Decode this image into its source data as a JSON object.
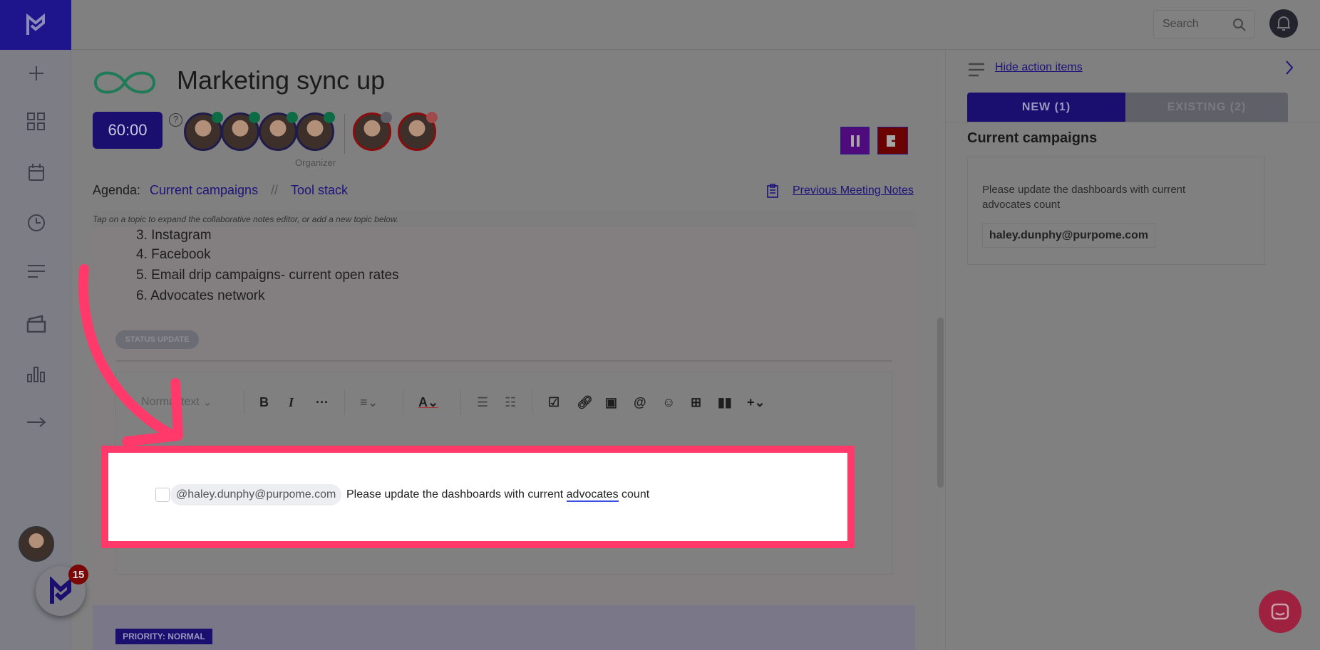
{
  "app": {
    "logo": "meetingfull-logo",
    "colors": {
      "brand": "#1e158c",
      "highlight": "#ff3a6a"
    }
  },
  "topbar": {
    "search_placeholder": "Search",
    "bell": "bell-icon"
  },
  "sidebar": {
    "items": [
      {
        "icon": "plus-icon"
      },
      {
        "icon": "grid-icon"
      },
      {
        "icon": "calendar-icon"
      },
      {
        "icon": "clock-icon"
      },
      {
        "icon": "notes-icon"
      },
      {
        "icon": "folder-icon"
      },
      {
        "icon": "chart-icon"
      },
      {
        "icon": "arrow-right-icon"
      }
    ],
    "badge_count": "15"
  },
  "meeting": {
    "title": "Marketing sync up",
    "timer": "60:00",
    "organizer_label": "Organizer",
    "agenda_label": "Agenda:",
    "agenda": [
      "Current campaigns",
      "Tool stack"
    ],
    "agenda_separator": "//",
    "previous_notes": "Previous Meeting Notes",
    "hint": "Tap on a topic to expand the collaborative notes editor, or add a new topic below."
  },
  "notes": {
    "items": [
      "3. Instagram",
      "4. Facebook",
      "5. Email drip campaigns- current open rates",
      "6. Advocates network"
    ],
    "status_badge": "STATUS UPDATE",
    "priority_badge": "PRIORITY: NORMAL"
  },
  "editor": {
    "style_select": "Normal text",
    "toolbar": [
      "bold",
      "italic",
      "more",
      "align",
      "text-color",
      "bullet-list",
      "numbered-list",
      "checkbox",
      "link",
      "image",
      "mention",
      "emoji",
      "table",
      "columns",
      "insert"
    ]
  },
  "action_item": {
    "mention": "@haley.dunphy@purpome.com",
    "text_before": "Please update the dashboards with current ",
    "text_link": "advocates",
    "text_after": " count"
  },
  "right_panel": {
    "hide_link": "Hide action items",
    "tabs": [
      {
        "label": "NEW (1)",
        "active": true
      },
      {
        "label": "EXISTING (2)",
        "active": false
      }
    ],
    "section_title": "Current campaigns",
    "item_text": "Please update the dashboards with current advocates count",
    "assignee": "haley.dunphy@purpome.com"
  }
}
